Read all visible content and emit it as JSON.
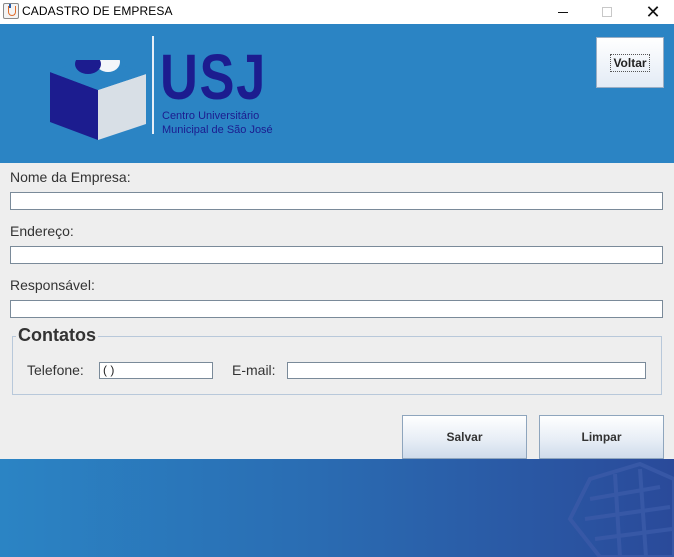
{
  "window": {
    "title": "CADASTRO DE EMPRESA",
    "minimize_glyph": "",
    "maximize_glyph": "",
    "close_glyph": "✕"
  },
  "header": {
    "logo_text": "USJ",
    "logo_subtitle_1": "Centro Universitário",
    "logo_subtitle_2": "Municipal de São José",
    "back_button_label": "Voltar"
  },
  "form": {
    "company_name_label": "Nome da Empresa:",
    "company_name_value": "",
    "address_label": "Endereço:",
    "address_value": "",
    "responsible_label": "Responsável:",
    "responsible_value": ""
  },
  "contacts": {
    "group_title": "Contatos",
    "phone_label": "Telefone:",
    "phone_value": "(  )",
    "email_label": "E-mail:",
    "email_value": ""
  },
  "actions": {
    "save_label": "Salvar",
    "clear_label": "Limpar"
  },
  "colors": {
    "banner_blue": "#2b84c4",
    "logo_navy": "#1c1c8f",
    "footer_dark": "#2a4a9a"
  }
}
